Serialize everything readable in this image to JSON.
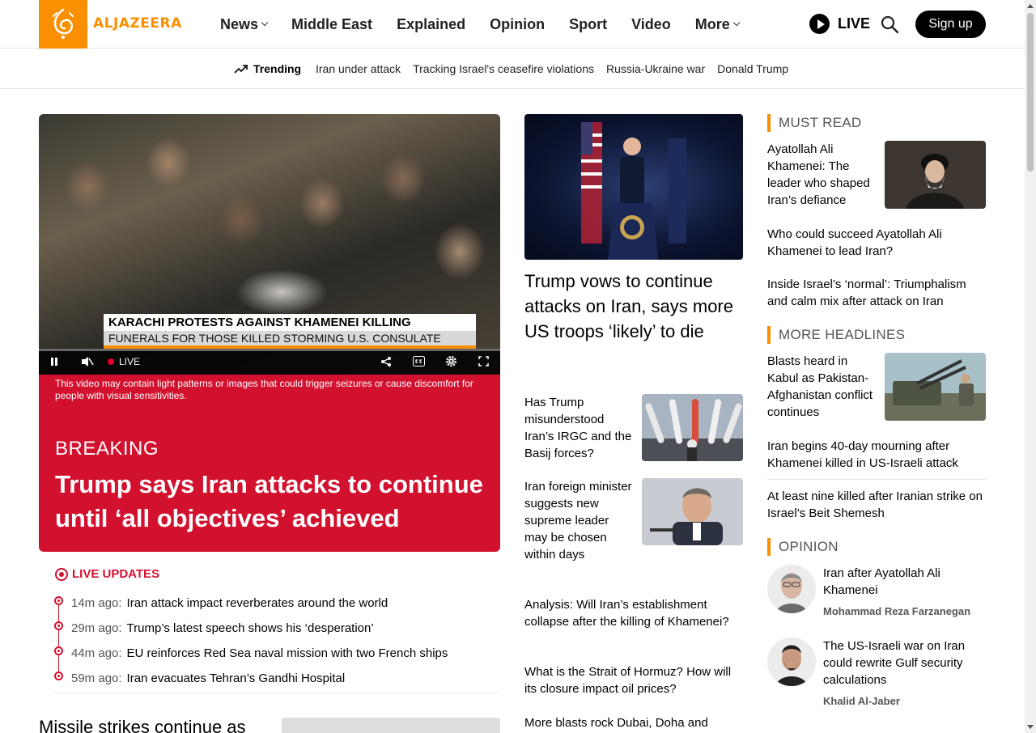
{
  "header": {
    "logo_text": "ALJAZEERA",
    "nav": [
      {
        "label": "News",
        "has_dropdown": true
      },
      {
        "label": "Middle East",
        "has_dropdown": false
      },
      {
        "label": "Explained",
        "has_dropdown": false
      },
      {
        "label": "Opinion",
        "has_dropdown": false
      },
      {
        "label": "Sport",
        "has_dropdown": false
      },
      {
        "label": "Video",
        "has_dropdown": false
      },
      {
        "label": "More",
        "has_dropdown": true
      }
    ],
    "live_label": "LIVE",
    "signup_label": "Sign up"
  },
  "trending": {
    "label": "Trending",
    "links": [
      "Iran under attack",
      "Tracking Israel's ceasefire violations",
      "Russia-Ukraine war",
      "Donald Trump"
    ]
  },
  "hero": {
    "lower_third_1": "KARACHI PROTESTS AGAINST KHAMENEI KILLING",
    "lower_third_2": "FUNERALS FOR THOSE KILLED STORMING U.S. CONSULATE",
    "live_label": "LIVE",
    "warning": "This video may contain light patterns or images that could trigger seizures or cause discomfort for people with visual sensitivities.",
    "breaking_label": "BREAKING",
    "title": "Trump says Iran attacks to continue until ‘all objectives’ achieved"
  },
  "live_updates": {
    "label": "LIVE UPDATES",
    "items": [
      {
        "time": "14m ago:",
        "text": "Iran attack impact reverberates around the world"
      },
      {
        "time": "29m ago:",
        "text": "Trump’s latest speech shows his ‘desperation’"
      },
      {
        "time": "44m ago:",
        "text": "EU reinforces Red Sea naval mission with two French ships"
      },
      {
        "time": "59m ago:",
        "text": "Iran evacuates Tehran’s Gandhi Hospital"
      }
    ]
  },
  "bottom_left_title": "Missile strikes continue as",
  "middle": {
    "main_title": "Trump vows to continue attacks on Iran, says more US troops ‘likely’ to die",
    "stories": [
      {
        "title": "Has Trump misunderstood Iran’s IRGC and the Basij forces?"
      },
      {
        "title": "Iran foreign minister suggests new supreme leader may be chosen within days"
      }
    ],
    "links": [
      "Analysis: Will Iran’s establishment collapse after the killing of Khamenei?",
      "What is the Strait of Hormuz? How will its closure impact oil prices?",
      "More blasts rock Dubai, Doha and"
    ]
  },
  "must_read": {
    "label": "MUST READ",
    "feature": "Ayatollah Ali Khamenei: The leader who shaped Iran’s defiance",
    "links": [
      "Who could succeed Ayatollah Ali Khamenei to lead Iran?",
      "Inside Israel’s ‘normal’: Triumphalism and calm mix after attack on Iran"
    ]
  },
  "more_headlines": {
    "label": "MORE HEADLINES",
    "feature": "Blasts heard in Kabul as Pakistan-Afghanistan conflict continues",
    "links": [
      "Iran begins 40-day mourning after Khamenei killed in US-Israeli attack",
      "At least nine killed after Iranian strike on Israel’s Beit Shemesh"
    ]
  },
  "opinion": {
    "label": "OPINION",
    "items": [
      {
        "title": "Iran after Ayatollah Ali Khamenei",
        "author": "Mohammad Reza Farzanegan"
      },
      {
        "title": "The US-Israeli war on Iran could rewrite Gulf security calculations",
        "author": "Khalid Al-Jaber"
      }
    ]
  },
  "colors": {
    "brand_orange": "#fa9000",
    "breaking_red": "#d2112f"
  }
}
